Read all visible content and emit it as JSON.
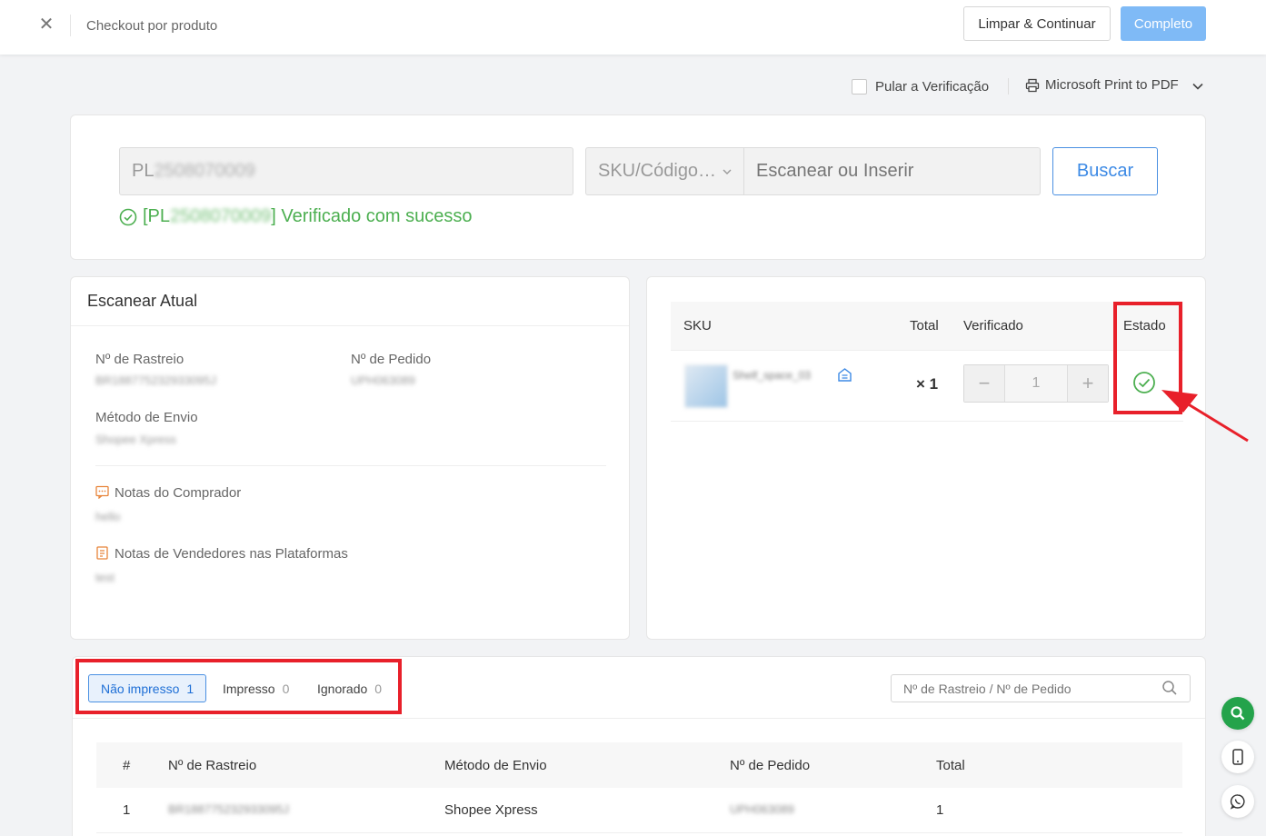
{
  "header": {
    "title": "Checkout por produto",
    "clear_button": "Limpar & Continuar",
    "complete_button": "Completo"
  },
  "options": {
    "skip_label": "Pular a Verificação",
    "printer": "Microsoft Print to PDF"
  },
  "scan": {
    "pl_prefix": "PL",
    "pl_blurred": "2508070009",
    "sku_select": "SKU/Código…",
    "scan_placeholder": "Escanear ou Inserir",
    "search_button": "Buscar",
    "success_prefix": "[PL",
    "success_blurred": "2508070009",
    "success_suffix": "] Verificado com sucesso"
  },
  "current": {
    "title": "Escanear Atual",
    "tracking_label": "Nº de Rastreio",
    "tracking_value": "BR188775232933095J",
    "order_label": "Nº de Pedido",
    "order_value": "UPH063089",
    "shipping_label": "Método de Envio",
    "shipping_value": "Shopee Xpress",
    "buyer_notes_label": "Notas do Comprador",
    "buyer_notes_value": "hello",
    "seller_notes_label": "Notas de Vendedores nas Plataformas",
    "seller_notes_value": "test"
  },
  "sku_table": {
    "headers": {
      "sku": "SKU",
      "total": "Total",
      "verified": "Verificado",
      "status": "Estado"
    },
    "row": {
      "name": "Shelf_space_03",
      "qty": "× 1",
      "verified": "1"
    }
  },
  "list": {
    "tabs": [
      {
        "label": "Não impresso",
        "count": "1"
      },
      {
        "label": "Impresso",
        "count": "0"
      },
      {
        "label": "Ignorado",
        "count": "0"
      }
    ],
    "search_placeholder": "Nº de Rastreio / Nº de Pedido",
    "headers": {
      "idx": "#",
      "tracking": "Nº de Rastreio",
      "shipping": "Método de Envio",
      "order": "Nº de Pedido",
      "total": "Total"
    },
    "rows": [
      {
        "idx": "1",
        "tracking": "BR188775232933095J",
        "shipping": "Shopee Xpress",
        "order": "UPH063089",
        "total": "1"
      }
    ]
  },
  "colors": {
    "accent": "#3d8ae5",
    "success": "#4caf50",
    "highlight": "#e8202a"
  }
}
